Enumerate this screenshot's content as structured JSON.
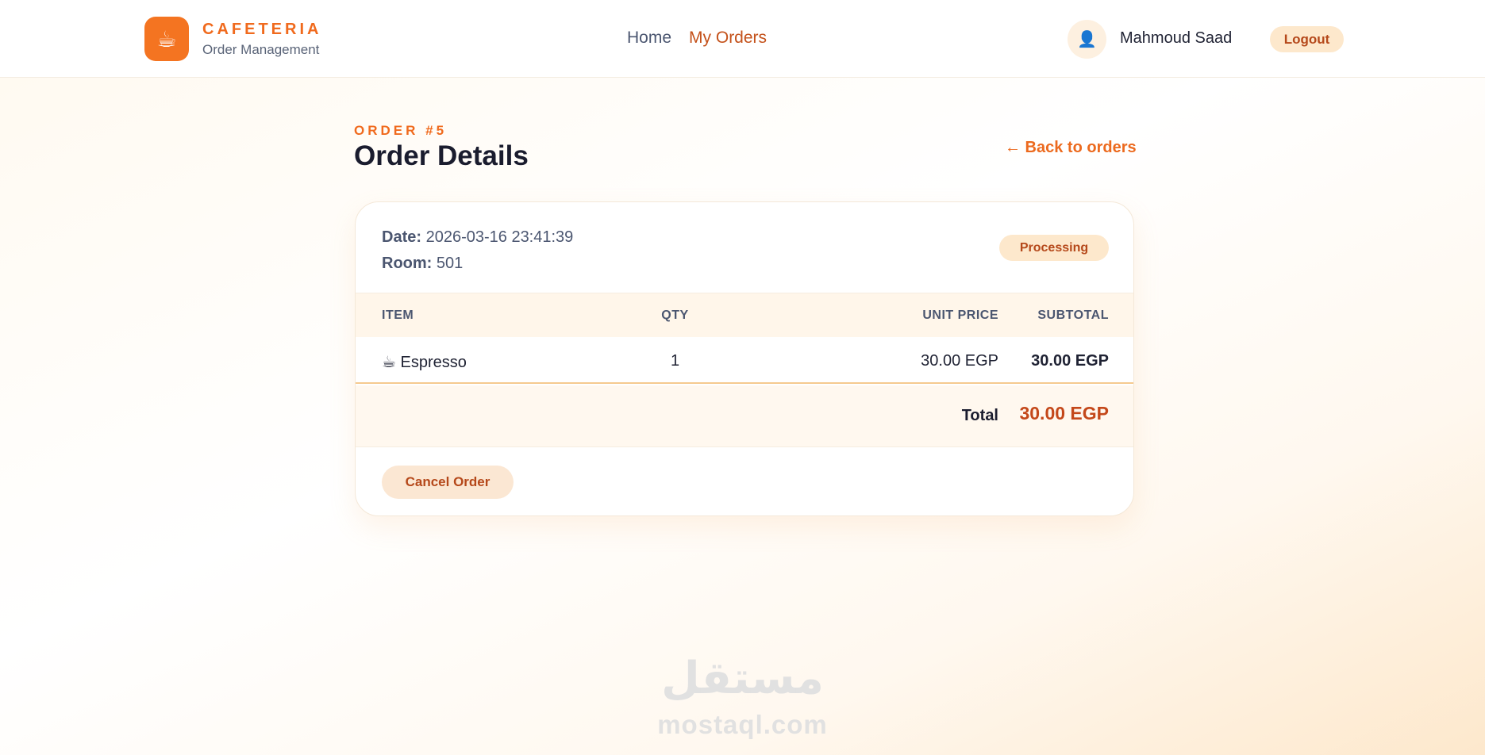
{
  "header": {
    "brand_name": "CAFETERIA",
    "brand_sub": "Order Management",
    "logo_glyph": "☕",
    "nav": [
      {
        "label": "Home",
        "active": false
      },
      {
        "label": "My Orders",
        "active": true
      }
    ],
    "avatar_glyph": "👤",
    "user_name": "Mahmoud Saad",
    "logout_label": "Logout"
  },
  "page": {
    "eyebrow": "ORDER #5",
    "title": "Order Details",
    "back_label": "← Back to orders"
  },
  "order": {
    "date_label": "Date:",
    "date_value": "2026-03-16 23:41:39",
    "room_label": "Room:",
    "room_value": "501",
    "status": "Processing",
    "columns": {
      "item": "ITEM",
      "qty": "QTY",
      "unit_price": "UNIT PRICE",
      "subtotal": "SUBTOTAL"
    },
    "items": [
      {
        "icon": "☕",
        "name": "Espresso",
        "qty": "1",
        "unit_price": "30.00 EGP",
        "subtotal": "30.00 EGP"
      }
    ],
    "total_label": "Total",
    "total_value": "30.00 EGP",
    "cancel_label": "Cancel Order"
  },
  "watermark": {
    "arabic": "مستقل",
    "latin": "mostaql.com"
  },
  "colors": {
    "accent": "#f06a1d",
    "accent_dark": "#c4481a",
    "badge_bg": "#fde8cc"
  }
}
